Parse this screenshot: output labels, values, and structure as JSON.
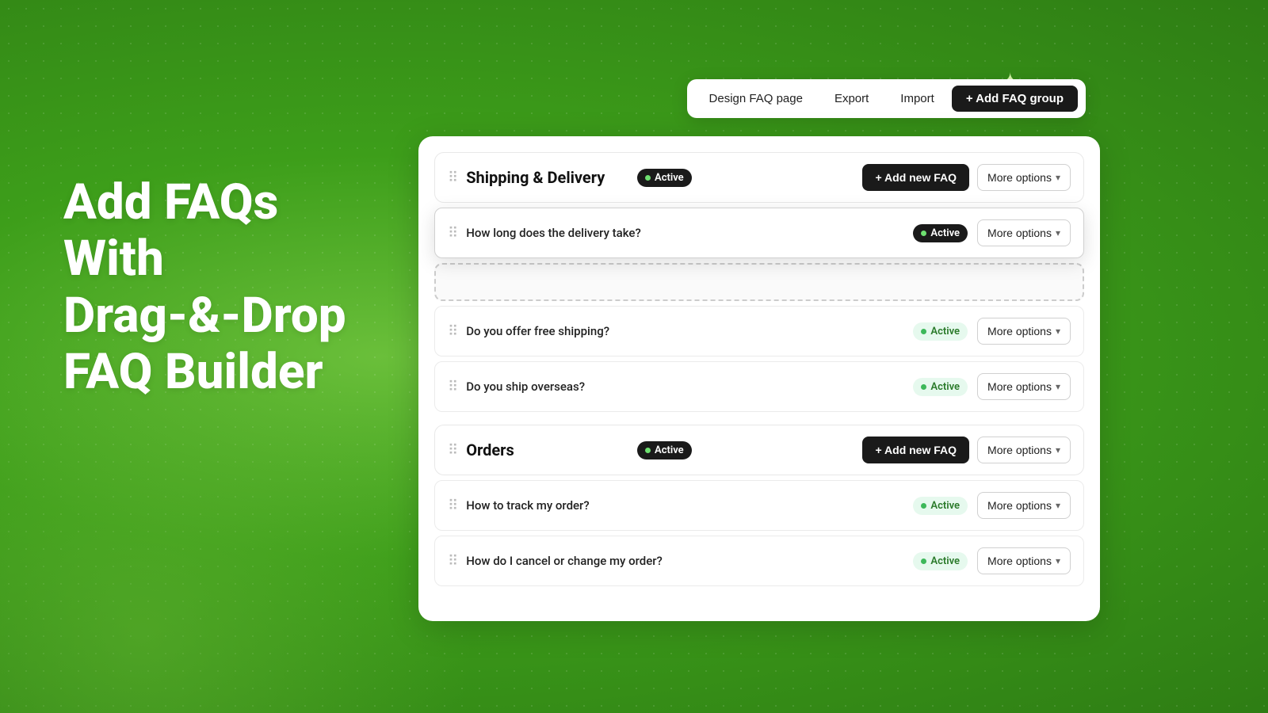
{
  "background": {
    "color": "#4ab520"
  },
  "hero": {
    "line1": "Add FAQs",
    "line2": "With",
    "line3": "Drag-&-Drop",
    "line4": "FAQ Builder"
  },
  "toolbar": {
    "design_label": "Design FAQ page",
    "export_label": "Export",
    "import_label": "Import",
    "add_group_label": "+ Add FAQ group"
  },
  "groups": [
    {
      "id": "shipping-delivery",
      "title": "Shipping & Delivery",
      "status": "Active",
      "add_faq_label": "+ Add new FAQ",
      "more_options_label": "More options",
      "items": [
        {
          "question": "How long does the delivery take?",
          "status": "Active",
          "dragging": true,
          "more_options_label": "More options"
        },
        {
          "question": "Do you offer free shipping?",
          "status": "Active",
          "dragging": false,
          "more_options_label": "More options"
        },
        {
          "question": "Do you ship overseas?",
          "status": "Active",
          "dragging": false,
          "more_options_label": "More options"
        }
      ]
    },
    {
      "id": "orders",
      "title": "Orders",
      "status": "Active",
      "add_faq_label": "+ Add new FAQ",
      "more_options_label": "More options",
      "items": [
        {
          "question": "How to track my order?",
          "status": "Active",
          "dragging": false,
          "more_options_label": "More options"
        },
        {
          "question": "How do I cancel or change my order?",
          "status": "Active",
          "dragging": false,
          "more_options_label": "More options"
        }
      ]
    }
  ]
}
